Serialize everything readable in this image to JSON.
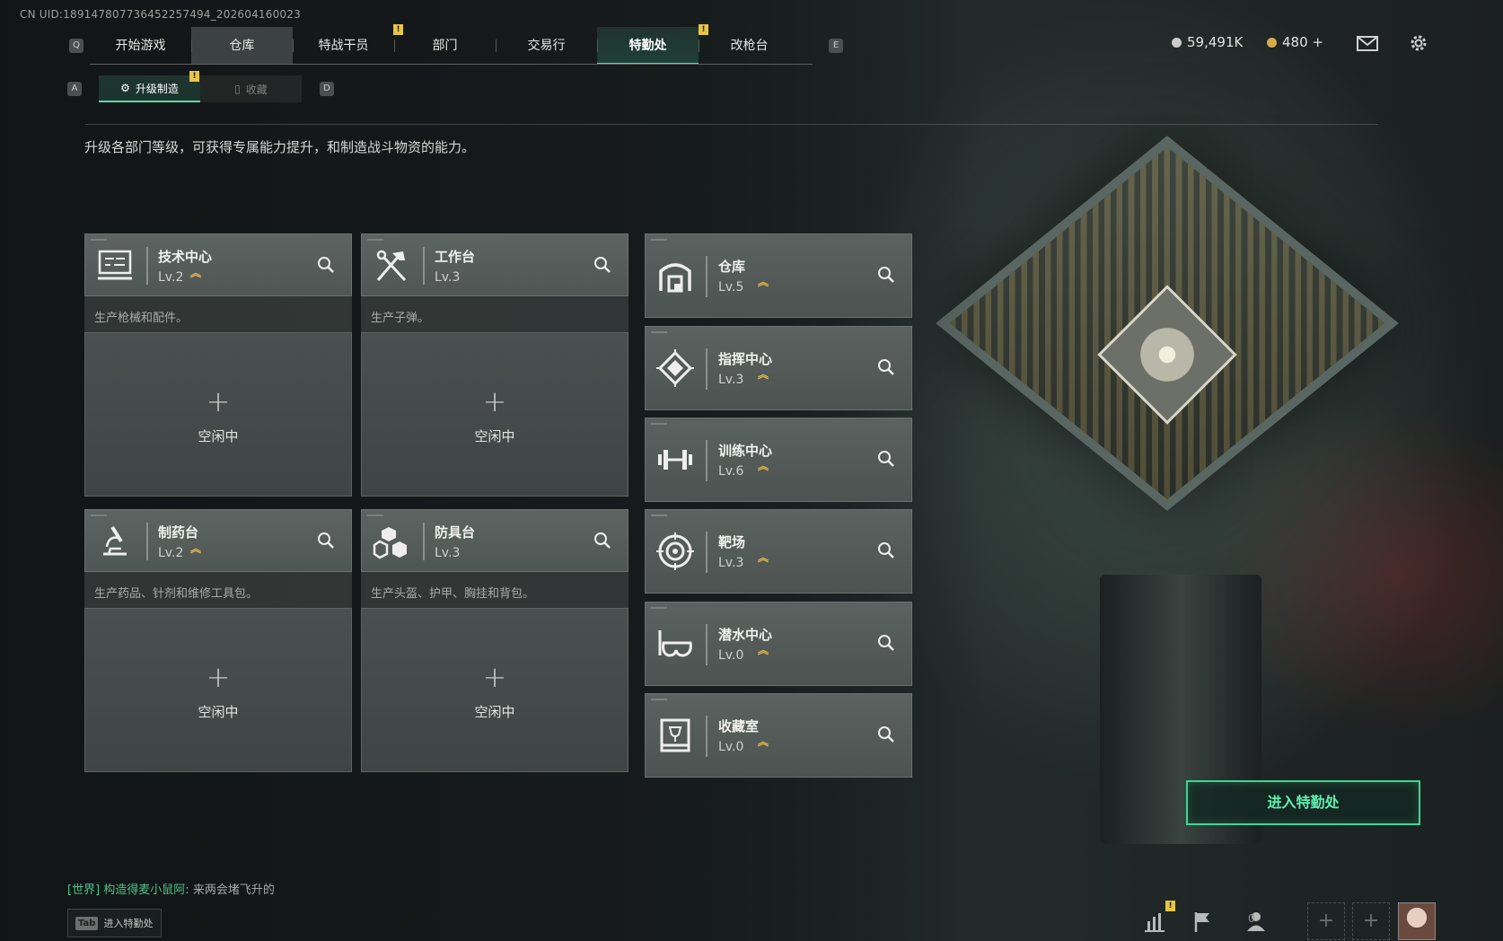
{
  "uid": "CN UID:189147807736452257494_202604160023",
  "keys": {
    "prev_tab": "Q",
    "next_tab": "E",
    "prev_sub": "A",
    "next_sub": "D"
  },
  "nav": {
    "tabs": [
      "开始游戏",
      "仓库",
      "特战干员",
      "部门",
      "交易行",
      "特勤处",
      "改枪台"
    ],
    "active_index": 5
  },
  "alerts": {
    "badge": "!"
  },
  "currency": {
    "coins": "59,491K",
    "gold": "480 +"
  },
  "subnav": {
    "upgrade": "升级制造",
    "collect": "收藏"
  },
  "description": "升级各部门等级，可获得专属能力提升，和制造战斗物资的能力。",
  "facilities_left": [
    {
      "name": "技术中心",
      "level": "Lv.2",
      "upgradable": true,
      "desc": "生产枪械和配件。",
      "status_plus": "+",
      "status": "空闲中",
      "icon": "computer-terminal-icon"
    },
    {
      "name": "工作台",
      "level": "Lv.3",
      "upgradable": false,
      "desc": "生产子弹。",
      "status_plus": "+",
      "status": "空闲中",
      "icon": "hammer-wrench-icon"
    },
    {
      "name": "制药台",
      "level": "Lv.2",
      "upgradable": true,
      "desc": "生产药品、针剂和维修工具包。",
      "status_plus": "+",
      "status": "空闲中",
      "icon": "microscope-icon"
    },
    {
      "name": "防具台",
      "level": "Lv.3",
      "upgradable": false,
      "desc": "生产头盔、护甲、胸挂和背包。",
      "status_plus": "+",
      "status": "空闲中",
      "icon": "armor-blocks-icon"
    }
  ],
  "facilities_right": [
    {
      "name": "仓库",
      "level": "Lv.5",
      "icon": "warehouse-icon"
    },
    {
      "name": "指挥中心",
      "level": "Lv.3",
      "icon": "command-emblem-icon"
    },
    {
      "name": "训练中心",
      "level": "Lv.6",
      "icon": "dumbbell-icon"
    },
    {
      "name": "靶场",
      "level": "Lv.3",
      "icon": "target-icon"
    },
    {
      "name": "潜水中心",
      "level": "Lv.0",
      "icon": "diving-mask-icon"
    },
    {
      "name": "收藏室",
      "level": "Lv.0",
      "icon": "trophy-case-icon"
    }
  ],
  "enter_button": "进入特勤处",
  "chat": {
    "channel": "[世界]",
    "sender": "构造得麦小鼠阿:",
    "message": "来两会堵飞升的"
  },
  "tab_hint": {
    "key": "Tab",
    "label": "进入特勤处"
  },
  "friends_count": "0",
  "upgrade_glyph": "︽",
  "colors": {
    "accent": "#4fe0a5",
    "upgrade": "#e7bb4e",
    "badge": "#e7c544"
  }
}
